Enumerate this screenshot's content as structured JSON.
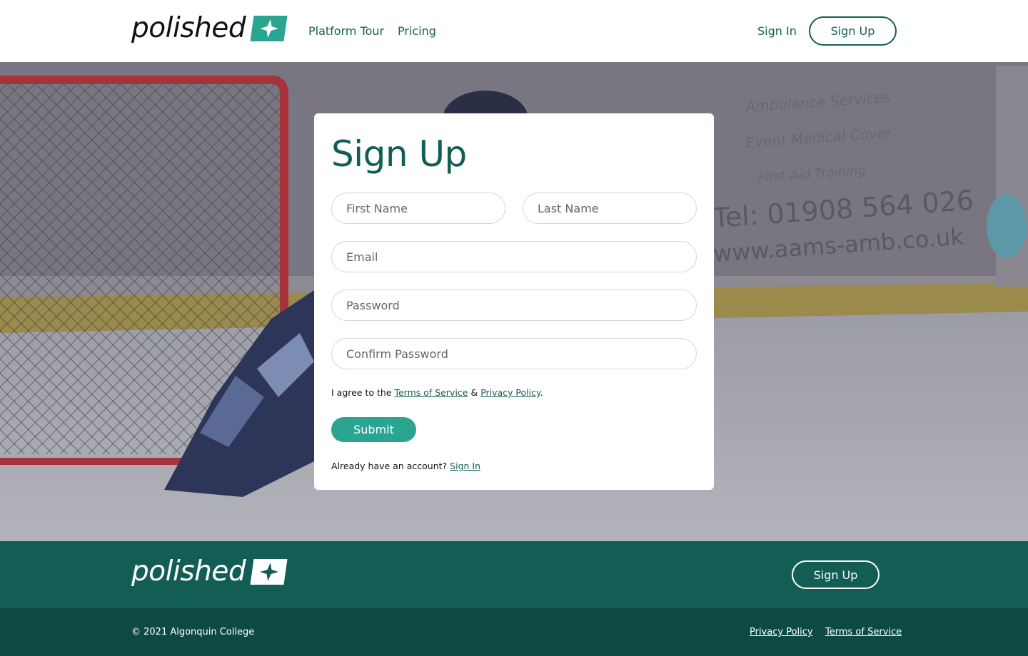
{
  "header": {
    "logo_text": "polished",
    "nav": [
      {
        "label": "Platform Tour"
      },
      {
        "label": "Pricing"
      }
    ],
    "sign_in_label": "Sign In",
    "sign_up_label": "Sign Up"
  },
  "hero": {
    "background_sign_lines": [
      "Ambulance Services",
      "Event Medical Cover",
      "First Aid Training",
      "Tel: 01908 564 026",
      "www.aams-amb.co.uk"
    ]
  },
  "form": {
    "title": "Sign Up",
    "first_name_placeholder": "First Name",
    "last_name_placeholder": "Last Name",
    "email_placeholder": "Email",
    "password_placeholder": "Password",
    "confirm_password_placeholder": "Confirm Password",
    "agree_prefix": "I agree to the ",
    "terms_link": "Terms of Service",
    "agree_join": " & ",
    "privacy_link": "Privacy Policy",
    "agree_suffix": ".",
    "submit_label": "Submit",
    "already_text": "Already have an account? ",
    "sign_in_link": "Sign In"
  },
  "footer": {
    "logo_text": "polished",
    "sign_up_label": "Sign Up",
    "copyright": "© 2021 Algonquin College",
    "privacy_link": "Privacy Policy",
    "terms_link": "Terms of Service"
  },
  "colors": {
    "brand_dark": "#135e54",
    "brand_accent": "#2aa58f",
    "footer_bottom": "#0c4a43"
  }
}
